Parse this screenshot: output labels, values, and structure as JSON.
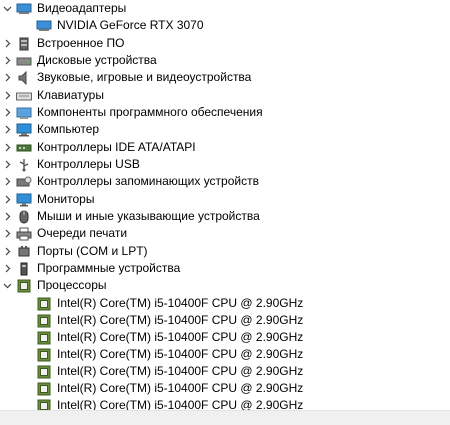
{
  "tree": {
    "categories": [
      {
        "label": "Видеоадаптеры",
        "expanded": true,
        "icon": "display-adapter-icon"
      },
      {
        "label": "Встроенное ПО",
        "expanded": false,
        "icon": "firmware-icon"
      },
      {
        "label": "Дисковые устройства",
        "expanded": false,
        "icon": "disk-drive-icon"
      },
      {
        "label": "Звуковые, игровые и видеоустройства",
        "expanded": false,
        "icon": "speaker-icon"
      },
      {
        "label": "Клавиатуры",
        "expanded": false,
        "icon": "keyboard-icon"
      },
      {
        "label": "Компоненты программного обеспечения",
        "expanded": false,
        "icon": "software-component-icon"
      },
      {
        "label": "Компьютер",
        "expanded": false,
        "icon": "computer-icon"
      },
      {
        "label": "Контроллеры IDE ATA/ATAPI",
        "expanded": false,
        "icon": "ide-controller-icon"
      },
      {
        "label": "Контроллеры USB",
        "expanded": false,
        "icon": "usb-icon"
      },
      {
        "label": "Контроллеры запоминающих устройств",
        "expanded": false,
        "icon": "storage-controller-icon"
      },
      {
        "label": "Мониторы",
        "expanded": false,
        "icon": "monitor-icon"
      },
      {
        "label": "Мыши и иные указывающие устройства",
        "expanded": false,
        "icon": "mouse-icon"
      },
      {
        "label": "Очереди печати",
        "expanded": false,
        "icon": "printer-icon"
      },
      {
        "label": "Порты (COM и LPT)",
        "expanded": false,
        "icon": "port-icon"
      },
      {
        "label": "Программные устройства",
        "expanded": false,
        "icon": "software-device-icon"
      },
      {
        "label": "Процессоры",
        "expanded": true,
        "icon": "processor-icon"
      }
    ],
    "display_adapter_child": {
      "label": "NVIDIA GeForce RTX 3070",
      "icon": "display-adapter-icon"
    },
    "processor_children": [
      {
        "label": "Intel(R) Core(TM) i5-10400F CPU @ 2.90GHz",
        "icon": "processor-icon"
      },
      {
        "label": "Intel(R) Core(TM) i5-10400F CPU @ 2.90GHz",
        "icon": "processor-icon"
      },
      {
        "label": "Intel(R) Core(TM) i5-10400F CPU @ 2.90GHz",
        "icon": "processor-icon"
      },
      {
        "label": "Intel(R) Core(TM) i5-10400F CPU @ 2.90GHz",
        "icon": "processor-icon"
      },
      {
        "label": "Intel(R) Core(TM) i5-10400F CPU @ 2.90GHz",
        "icon": "processor-icon"
      },
      {
        "label": "Intel(R) Core(TM) i5-10400F CPU @ 2.90GHz",
        "icon": "processor-icon"
      },
      {
        "label": "Intel(R) Core(TM) i5-10400F CPU @ 2.90GHz",
        "icon": "processor-icon"
      }
    ]
  },
  "colors": {
    "processor_green": "#4f7a2a",
    "monitor_blue": "#2f8fd8"
  }
}
